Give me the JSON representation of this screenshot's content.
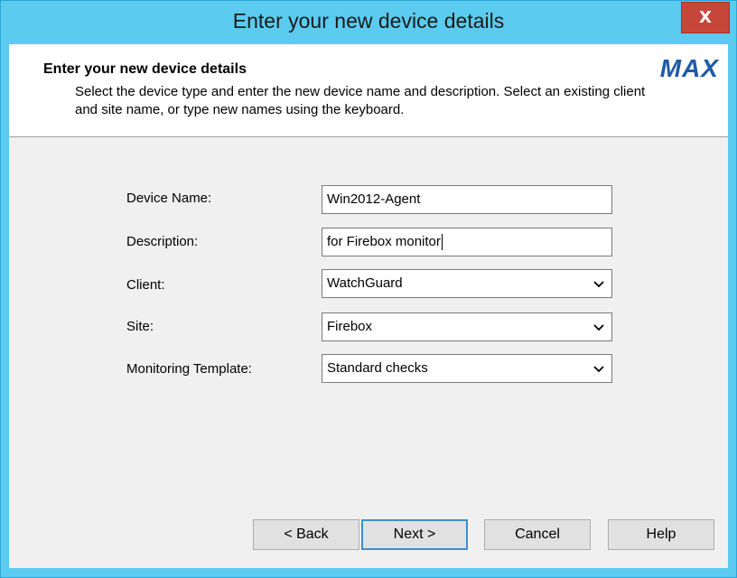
{
  "window": {
    "title": "Enter your new device details",
    "close_glyph": "X"
  },
  "header": {
    "title": "Enter your new device details",
    "description": "Select the device type and enter the new device name and description. Select an existing client and site name, or type new names using the keyboard.",
    "logo": "MAX"
  },
  "form": {
    "device_name": {
      "label": "Device Name:",
      "value": "Win2012-Agent"
    },
    "description": {
      "label": "Description:",
      "value": "for Firebox monitor"
    },
    "client": {
      "label": "Client:",
      "value": "WatchGuard",
      "icon": "chevron-down-icon"
    },
    "site": {
      "label": "Site:",
      "value": "Firebox",
      "icon": "chevron-down-icon"
    },
    "monitoring_template": {
      "label": "Monitoring Template:",
      "value": "Standard checks",
      "icon": "chevron-down-icon"
    }
  },
  "buttons": {
    "back": "< Back",
    "next": "Next >",
    "cancel": "Cancel",
    "help": "Help"
  },
  "colors": {
    "title_bar": "#5bcbf0",
    "close_button": "#c7463a",
    "logo": "#1e5aa8",
    "dialog_body": "#f0f0f0",
    "default_button_border": "#3c8fd1"
  }
}
